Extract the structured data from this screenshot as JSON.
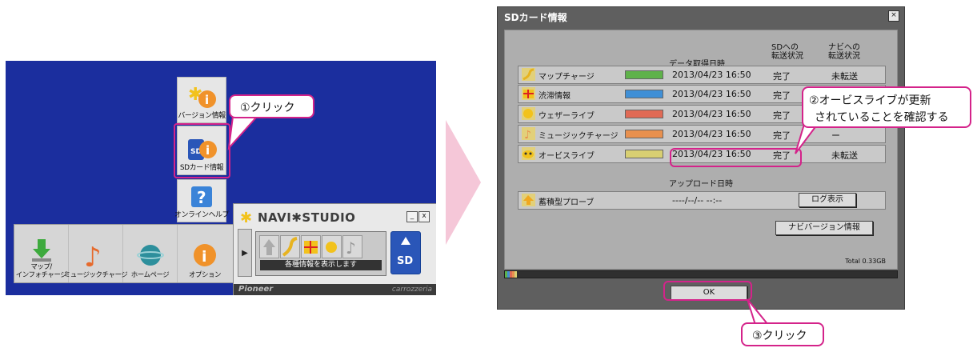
{
  "desktop": {
    "vertical_buttons": [
      {
        "label": "バージョン情報",
        "icon": "version-info-icon"
      },
      {
        "label": "SDカード情報",
        "icon": "sd-card-info-icon"
      },
      {
        "label": "オンラインヘルプ",
        "icon": "help-icon"
      }
    ],
    "taskbar": [
      {
        "label1": "マップ/",
        "label2": "インフォチャージ",
        "icon": "map-download-icon"
      },
      {
        "label1": "",
        "label2": "ミュージックチャージ",
        "icon": "music-note-icon"
      },
      {
        "label1": "",
        "label2": "ホームページ",
        "icon": "globe-icon"
      },
      {
        "label1": "",
        "label2": "オプション",
        "icon": "info-icon"
      }
    ],
    "navi": {
      "title": "NAVI✱STUDIO",
      "message": "各種情報を表示します",
      "brand_left": "Pioneer",
      "brand_right": "carrozzeria",
      "minimize": "_",
      "close": "x"
    }
  },
  "callouts": {
    "step1": "①クリック",
    "step2_line1": "②オービスライブが更新",
    "step2_line2": "されていることを確認する",
    "step3": "③クリック"
  },
  "dialog": {
    "title": "SDカード情報",
    "close": "×",
    "headers": {
      "date": "データ取得日時",
      "sd_l1": "SDへの",
      "sd_l2": "転送状況",
      "navi_l1": "ナビへの",
      "navi_l2": "転送状況"
    },
    "rows": [
      {
        "name": "マップチャージ",
        "color": "#5fb24a",
        "date": "2013/04/23 16:50",
        "sd": "完了",
        "navi": "未転送"
      },
      {
        "name": "渋滞情報",
        "color": "#3f8fd6",
        "date": "2013/04/23 16:50",
        "sd": "完了",
        "navi": ""
      },
      {
        "name": "ウェザーライブ",
        "color": "#e06a55",
        "date": "2013/04/23 16:50",
        "sd": "完了",
        "navi": ""
      },
      {
        "name": "ミュージックチャージ",
        "color": "#e8904e",
        "date": "2013/04/23 16:50",
        "sd": "完了",
        "navi": "ー"
      },
      {
        "name": "オービスライブ",
        "color": "#d8cf72",
        "date": "2013/04/23 16:50",
        "sd": "完了",
        "navi": "未転送"
      }
    ],
    "upload_header": "アップロード日時",
    "probe": {
      "name": "蓄積型プローブ",
      "date": "----/--/-- --:--",
      "button": "ログ表示"
    },
    "version_button": "ナビバージョン情報",
    "total": "Total 0.33GB",
    "ok": "OK"
  }
}
